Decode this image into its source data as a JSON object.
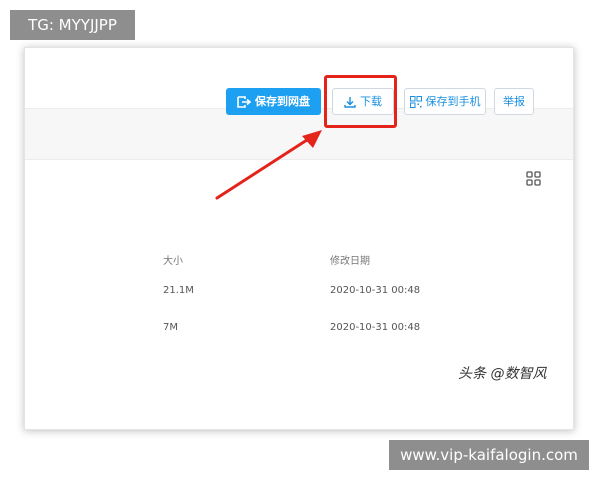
{
  "watermark": {
    "top_tag": "TG: MYYJJPP",
    "bottom_tag": "www.vip-kaifalogin.com",
    "brand": "头条 @数智风"
  },
  "toolbar": {
    "save_to_disk_label": "保存到网盘",
    "download_label": "下载",
    "save_to_phone_label": "保存到手机",
    "report_label": "举报"
  },
  "table": {
    "headers": {
      "size": "大小",
      "modified": "修改日期"
    },
    "rows": [
      {
        "size": "21.1M",
        "modified": "2020-10-31 00:48"
      },
      {
        "size": "7M",
        "modified": "2020-10-31 00:48"
      }
    ]
  },
  "colors": {
    "accent": "#1ea0f2",
    "highlight": "#e4231b",
    "link": "#1a8fe0"
  },
  "icons": {
    "save_to_disk": "save-to-disk-icon",
    "download": "download-icon",
    "save_to_phone": "qr-code-icon",
    "view_toggle": "grid-view-icon"
  }
}
